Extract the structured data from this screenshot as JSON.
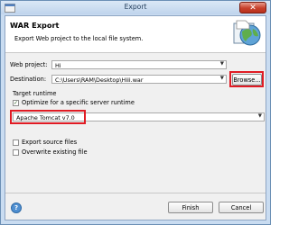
{
  "window": {
    "title": "Export",
    "close_label": "✕"
  },
  "banner": {
    "title": "WAR Export",
    "description": "Export Web project to the local file system."
  },
  "form": {
    "web_project_label": "Web project:",
    "web_project_value": "Hi",
    "destination_label": "Destination:",
    "destination_value": "C:\\Users\\RAM\\Desktop\\Hiii.war",
    "browse_label": "Browse...",
    "target_runtime_label": "Target runtime",
    "optimize_label": "Optimize for a specific server runtime",
    "optimize_checked": true,
    "runtime_value": "Apache Tomcat v7.0",
    "export_source_label": "Export source files",
    "export_source_checked": false,
    "overwrite_label": "Overwrite existing file",
    "overwrite_checked": false
  },
  "footer": {
    "help_label": "?",
    "finish_label": "Finish",
    "cancel_label": "Cancel"
  },
  "colors": {
    "highlight": "#e01b24",
    "titlebar": "#c9dcf1"
  }
}
